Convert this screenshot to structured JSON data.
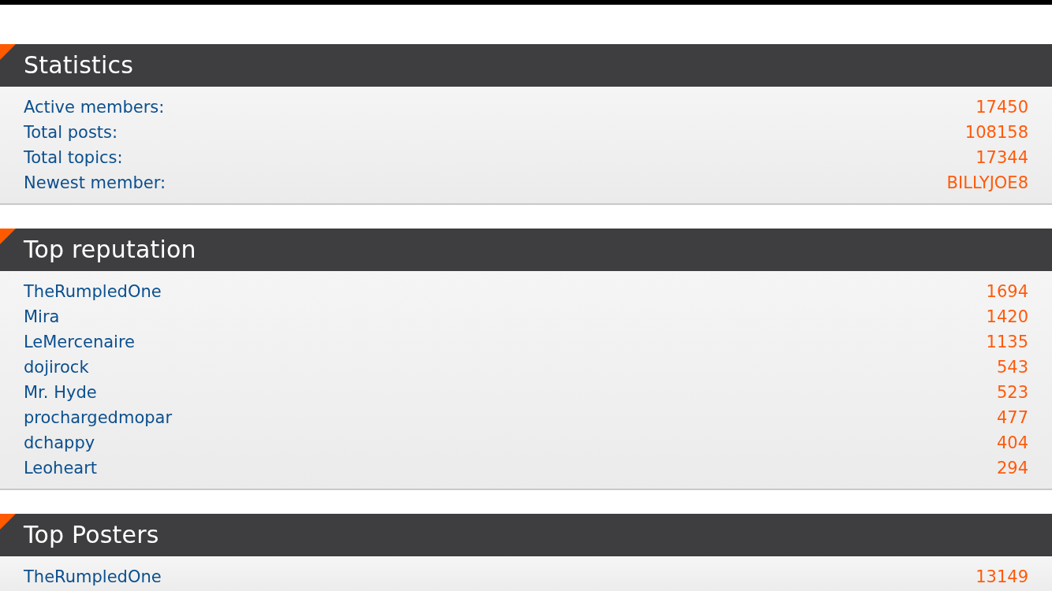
{
  "statistics": {
    "title": "Statistics",
    "rows": [
      {
        "label": "Active members:",
        "value": "17450"
      },
      {
        "label": "Total posts:",
        "value": "108158"
      },
      {
        "label": "Total topics:",
        "value": "17344"
      },
      {
        "label": "Newest member:",
        "value": "BILLYJOE8"
      }
    ]
  },
  "top_reputation": {
    "title": "Top reputation",
    "members": [
      {
        "name": "TheRumpledOne",
        "reputation": "1694"
      },
      {
        "name": "Mira",
        "reputation": "1420"
      },
      {
        "name": "LeMercenaire",
        "reputation": "1135"
      },
      {
        "name": "dojirock",
        "reputation": "543"
      },
      {
        "name": "Mr. Hyde",
        "reputation": "523"
      },
      {
        "name": "prochargedmopar",
        "reputation": "477"
      },
      {
        "name": "dchappy",
        "reputation": "404"
      },
      {
        "name": "Leoheart",
        "reputation": "294"
      }
    ]
  },
  "top_posters": {
    "title": "Top Posters",
    "members": [
      {
        "name": "TheRumpledOne",
        "posts": "13149"
      }
    ]
  }
}
